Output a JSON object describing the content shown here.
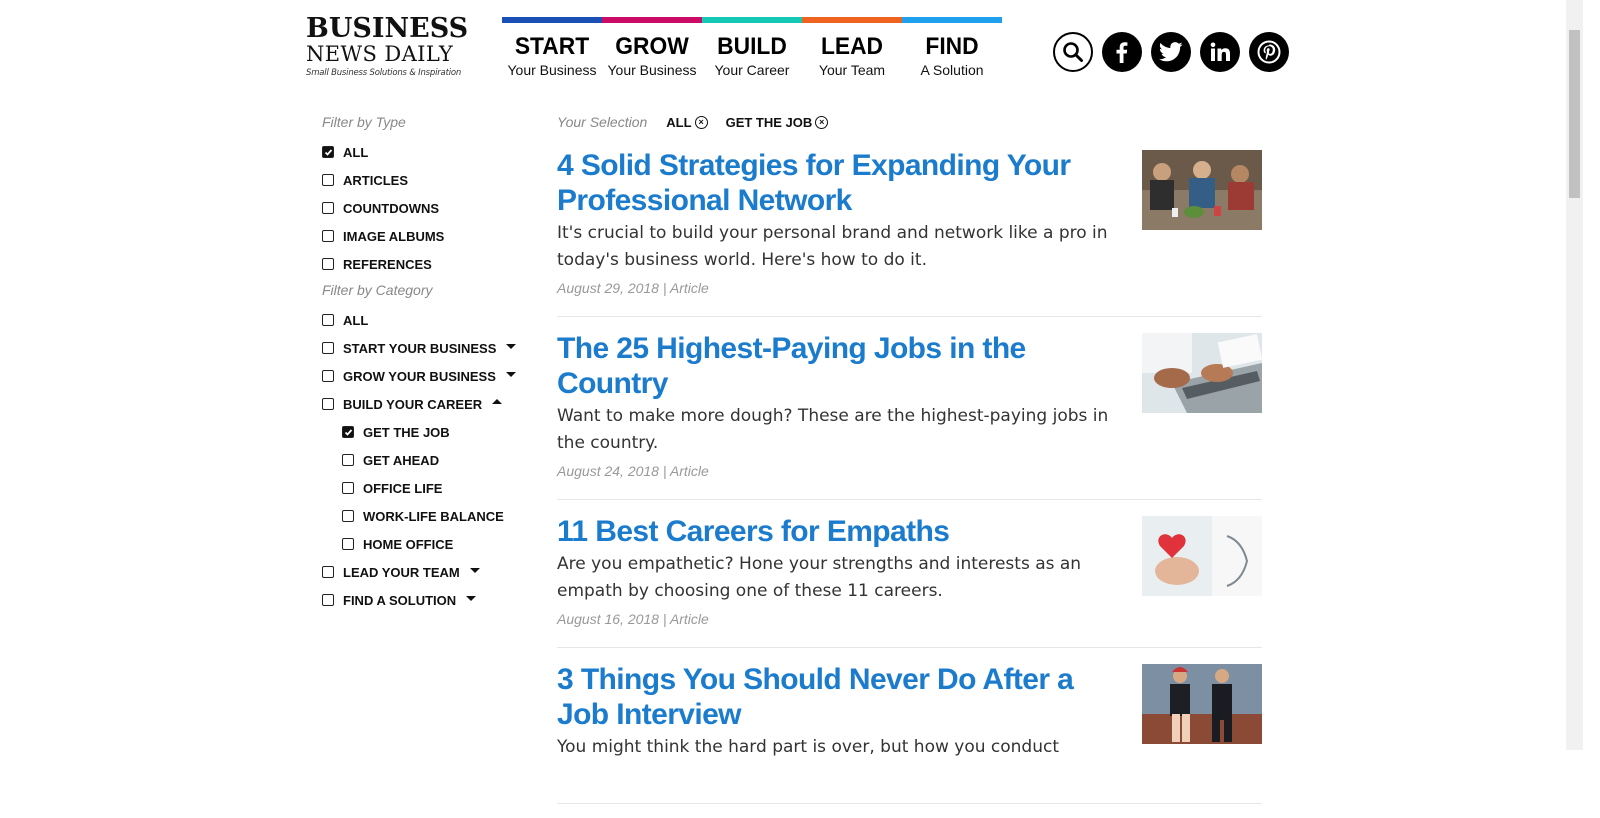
{
  "logo": {
    "line1": "BUSINESS",
    "line2": "NEWS DAILY",
    "tagline": "Small Business Solutions & Inspiration"
  },
  "nav": [
    {
      "main": "START",
      "sub": "Your Business",
      "color": "#1a4fb5"
    },
    {
      "main": "GROW",
      "sub": "Your Business",
      "color": "#cc0b66"
    },
    {
      "main": "BUILD",
      "sub": "Your Career",
      "color": "#14c8b6"
    },
    {
      "main": "LEAD",
      "sub": "Your Team",
      "color": "#f0621f"
    },
    {
      "main": "FIND",
      "sub": "A Solution",
      "color": "#1ea0ee"
    }
  ],
  "social": [
    "search-icon",
    "facebook-icon",
    "twitter-icon",
    "linkedin-icon",
    "pinterest-icon"
  ],
  "filters": {
    "type_title": "Filter by Type",
    "type_items": [
      {
        "label": "ALL",
        "checked": true
      },
      {
        "label": "ARTICLES",
        "checked": false
      },
      {
        "label": "COUNTDOWNS",
        "checked": false
      },
      {
        "label": "IMAGE ALBUMS",
        "checked": false
      },
      {
        "label": "REFERENCES",
        "checked": false
      }
    ],
    "category_title": "Filter by Category",
    "category_items": [
      {
        "label": "ALL",
        "checked": false
      },
      {
        "label": "START YOUR BUSINESS",
        "checked": false,
        "caret": "down"
      },
      {
        "label": "GROW YOUR BUSINESS",
        "checked": false,
        "caret": "down"
      },
      {
        "label": "BUILD YOUR CAREER",
        "checked": false,
        "caret": "up"
      },
      {
        "label": "GET THE JOB",
        "checked": true,
        "sub": true
      },
      {
        "label": "GET AHEAD",
        "checked": false,
        "sub": true
      },
      {
        "label": "OFFICE LIFE",
        "checked": false,
        "sub": true
      },
      {
        "label": "WORK-LIFE BALANCE",
        "checked": false,
        "sub": true
      },
      {
        "label": "HOME OFFICE",
        "checked": false,
        "sub": true
      },
      {
        "label": "LEAD YOUR TEAM",
        "checked": false,
        "caret": "down"
      },
      {
        "label": "FIND A SOLUTION",
        "checked": false,
        "caret": "down"
      }
    ]
  },
  "selection": {
    "label": "Your Selection",
    "chips": [
      "ALL",
      "GET THE JOB"
    ]
  },
  "articles": [
    {
      "title": "4 Solid Strategies for Expanding Your Professional Network",
      "desc": "It's crucial to build your personal brand and network like a pro in today's business world. Here's how to do it.",
      "meta": "August 29, 2018 | Article"
    },
    {
      "title": "The 25 Highest-Paying Jobs in the Country",
      "desc": "Want to make more dough? These are the highest-paying jobs in the country.",
      "meta": "August 24, 2018 | Article"
    },
    {
      "title": "11 Best Careers for Empaths",
      "desc": "Are you empathetic? Hone your strengths and interests as an empath by choosing one of these 11 careers.",
      "meta": "August 16, 2018 | Article"
    },
    {
      "title": "3 Things You Should Never Do After a Job Interview",
      "desc": "You might think the hard part is over, but how you conduct",
      "meta": ""
    }
  ]
}
